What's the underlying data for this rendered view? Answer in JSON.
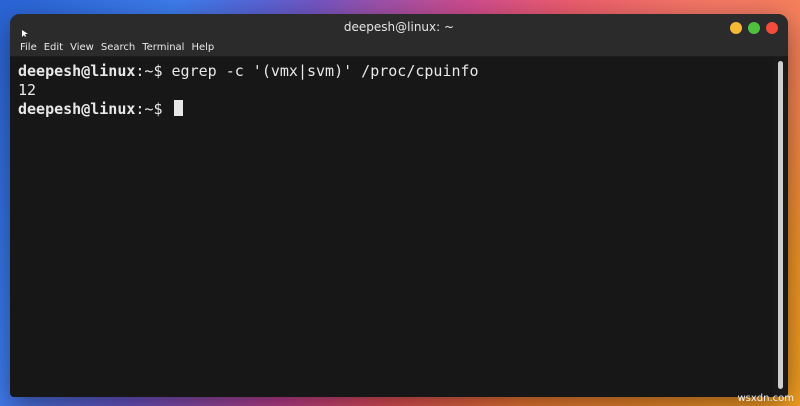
{
  "window": {
    "title": "deepesh@linux: ~"
  },
  "menu": [
    "File",
    "Edit",
    "View",
    "Search",
    "Terminal",
    "Help"
  ],
  "controls": {
    "minimize_color": "#f6b936",
    "maximize_color": "#4fc13f",
    "close_color": "#f24c3c"
  },
  "terminal": {
    "lines": [
      {
        "user_host": "deepesh@linux",
        "path": ":~$",
        "command": " egrep -c '(vmx|svm)' /proc/cpuinfo"
      },
      {
        "output": "12"
      },
      {
        "user_host": "deepesh@linux",
        "path": ":~$",
        "command": " "
      }
    ]
  },
  "watermark": "wsxdn.com"
}
